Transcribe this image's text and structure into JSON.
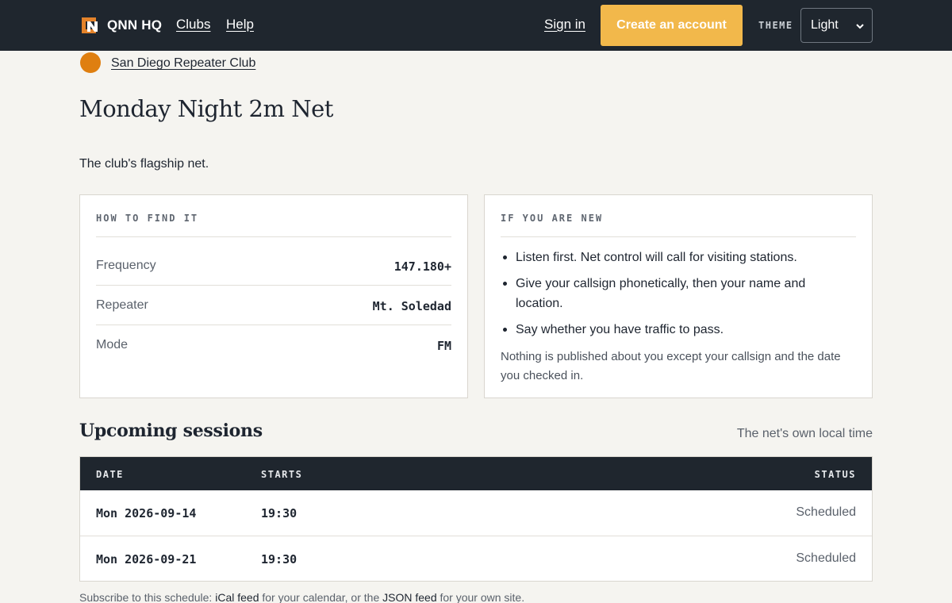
{
  "header": {
    "brand": "QNN HQ",
    "nav": [
      {
        "label": "Clubs"
      },
      {
        "label": "Help"
      }
    ],
    "sign_in": "Sign in",
    "create_account": "Create an account",
    "theme_label": "THEME",
    "theme_value": "Light"
  },
  "club": {
    "name": "San Diego Repeater Club",
    "color": "#df7f10"
  },
  "net": {
    "title": "Monday Night 2m Net",
    "description": "The club's flagship net."
  },
  "how_to_find": {
    "label": "HOW TO FIND IT",
    "rows": [
      {
        "key": "Frequency",
        "value": "147.180+"
      },
      {
        "key": "Repeater",
        "value": "Mt. Soledad"
      },
      {
        "key": "Mode",
        "value": "FM"
      }
    ]
  },
  "if_new": {
    "label": "IF YOU ARE NEW",
    "tips": [
      "Listen first. Net control will call for visiting stations.",
      "Give your callsign phonetically, then your name and location.",
      "Say whether you have traffic to pass."
    ],
    "privacy": "Nothing is published about you except your callsign and the date you checked in."
  },
  "sessions": {
    "title": "Upcoming sessions",
    "tz_note": "The net's own local time",
    "columns": [
      "DATE",
      "STARTS",
      "STATUS"
    ],
    "rows": [
      {
        "date": "Mon 2026-09-14",
        "starts": "19:30",
        "status": "Scheduled"
      },
      {
        "date": "Mon 2026-09-21",
        "starts": "19:30",
        "status": "Scheduled"
      }
    ]
  },
  "subscribe": {
    "prefix": "Subscribe to this schedule: ",
    "ical": "iCal feed",
    "middle": " for your calendar, or the ",
    "json": "JSON feed",
    "suffix": " for your own site."
  },
  "colors": {
    "header_bg": "#1f262e",
    "accent": "#f2b84b",
    "page_bg": "#f5f4f0"
  }
}
